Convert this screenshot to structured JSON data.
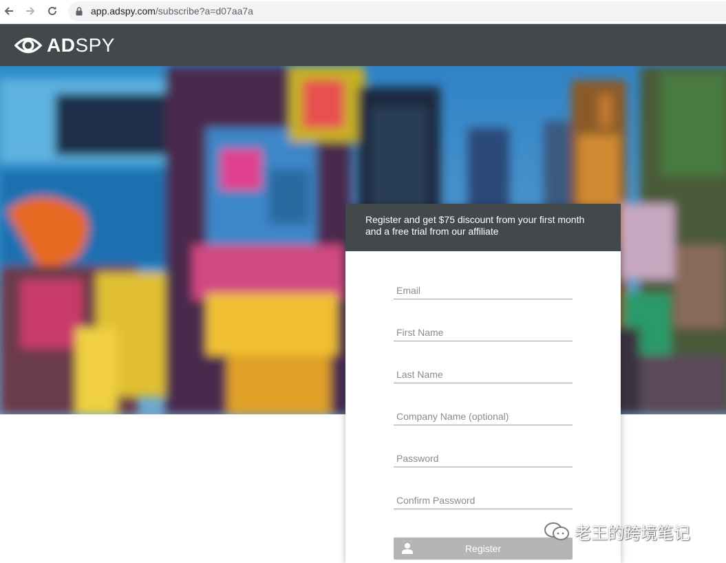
{
  "browser": {
    "url_domain": "app.adspy.com",
    "url_path": "/subscribe?a=d07aa7a"
  },
  "header": {
    "logo_bold": "AD",
    "logo_light": "SPY"
  },
  "form": {
    "title": "Register and get $75 discount from your first month and a free trial from our affiliate",
    "email_placeholder": "Email",
    "first_name_placeholder": "First Name",
    "last_name_placeholder": "Last Name",
    "company_placeholder": "Company Name (optional)",
    "password_placeholder": "Password",
    "confirm_password_placeholder": "Confirm Password",
    "register_label": "Register"
  },
  "watermark": {
    "text": "老王的跨境笔记"
  },
  "colors": {
    "header_bg": "#43484a",
    "button_bg": "#b3b5b7"
  }
}
